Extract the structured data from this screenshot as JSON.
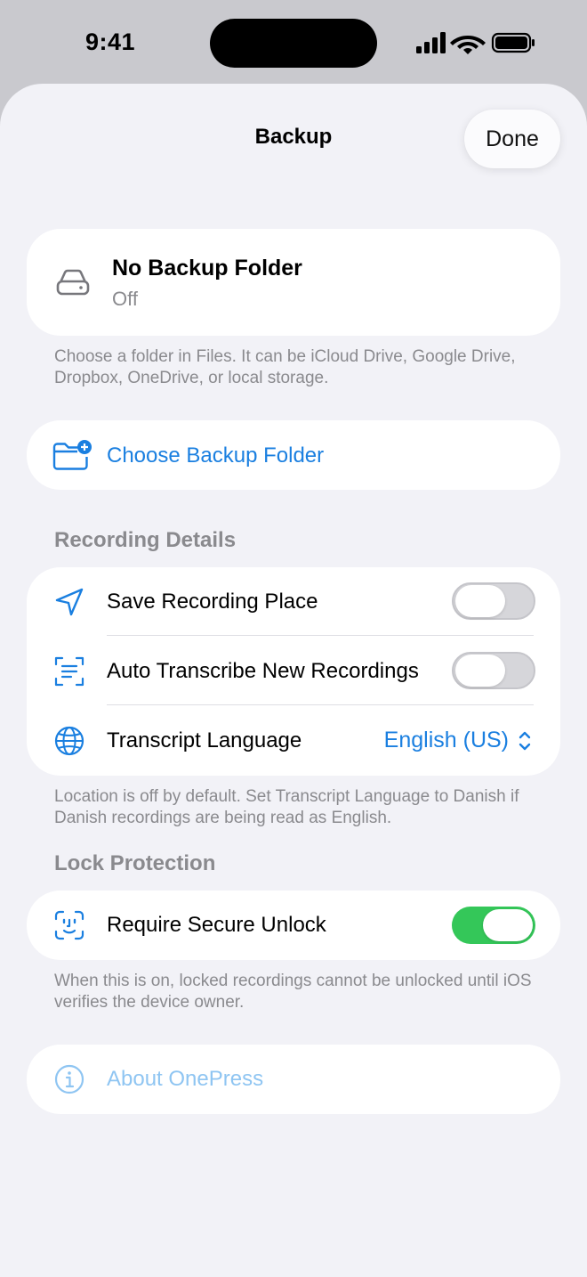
{
  "status_bar": {
    "time": "9:41",
    "icons": [
      "cellular-signal-icon",
      "wifi-icon",
      "battery-icon"
    ]
  },
  "sheet": {
    "title": "Backup",
    "done_label": "Done"
  },
  "backup_folder": {
    "title": "No Backup Folder",
    "status": "Off",
    "icon": "drive-icon",
    "footnote": "Choose a folder in Files. It can be iCloud Drive, Google Drive, Dropbox, OneDrive, or local storage."
  },
  "choose_folder": {
    "label": "Choose Backup Folder",
    "icon": "folder-plus-icon"
  },
  "recording_details": {
    "header": "Recording Details",
    "rows": [
      {
        "label": "Save Recording Place",
        "icon": "location-arrow-icon",
        "toggle": false
      },
      {
        "label": "Auto Transcribe New Recordings",
        "icon": "transcript-icon",
        "toggle": false
      },
      {
        "label": "Transcript Language",
        "icon": "globe-icon",
        "value": "English (US)"
      }
    ],
    "footnote": "Location is off by default. Set Transcript Language to Danish if Danish recordings are being read as English."
  },
  "lock_protection": {
    "header": "Lock Protection",
    "rows": [
      {
        "label": "Require Secure Unlock",
        "icon": "face-id-icon",
        "toggle": true
      }
    ],
    "footnote": "When this is on, locked recordings cannot be unlocked until iOS verifies the device owner."
  },
  "about": {
    "label": "About OnePress",
    "icon": "info-icon"
  },
  "colors": {
    "accent": "#1a7fe0",
    "toggle_on": "#34c759",
    "background": "#f2f2f7",
    "secondary_text": "#8a8a8e"
  }
}
